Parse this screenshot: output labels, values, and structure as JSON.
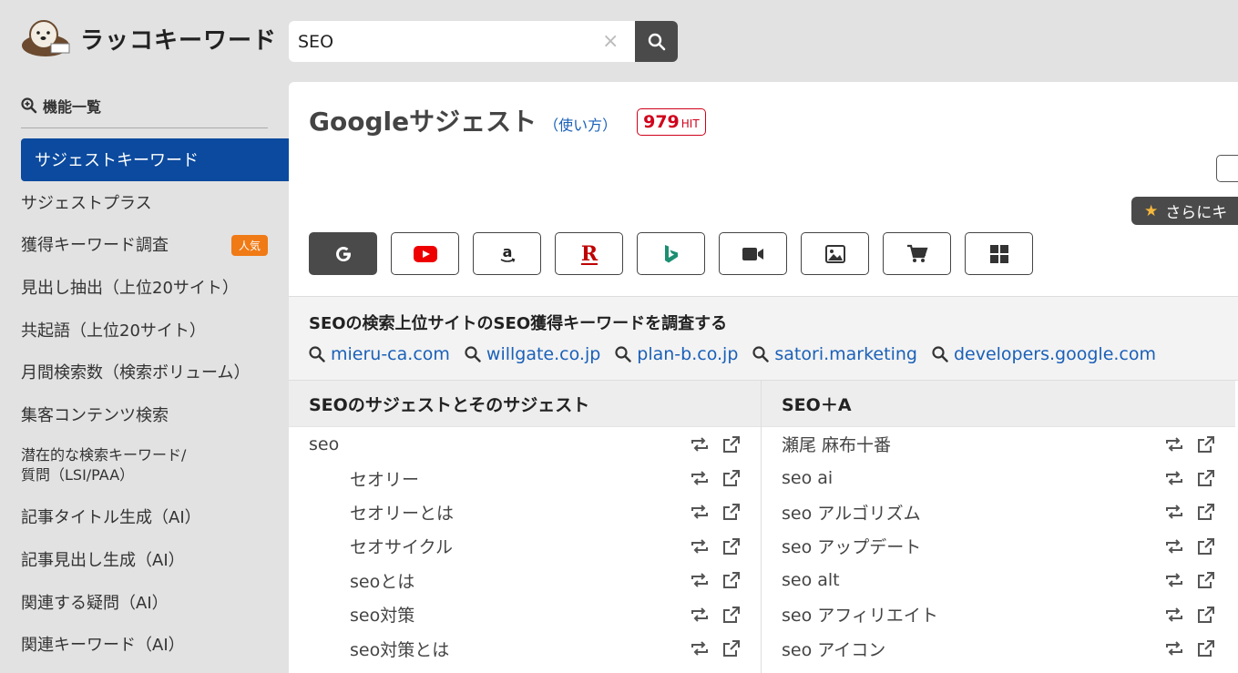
{
  "app": {
    "logo_text": "ラッコキーワード"
  },
  "search": {
    "value": "SEO",
    "clear": "×"
  },
  "sidebar": {
    "heading": "機能一覧",
    "items": [
      {
        "label": "サジェストキーワード"
      },
      {
        "label": "サジェストプラス"
      },
      {
        "label": "獲得キーワード調査",
        "badge": "人気"
      },
      {
        "label": "見出し抽出（上位20サイト）"
      },
      {
        "label": "共起語（上位20サイト）"
      },
      {
        "label": "月間検索数（検索ボリューム）"
      },
      {
        "label": "集客コンテンツ検索"
      },
      {
        "line1": "潜在的な検索キーワード/",
        "line2": "質問（LSI/PAA）"
      },
      {
        "label": "記事タイトル生成（AI）"
      },
      {
        "label": "記事見出し生成（AI）"
      },
      {
        "label": "関連する疑問（AI）"
      },
      {
        "label": "関連キーワード（AI）"
      }
    ]
  },
  "main": {
    "title": "Googleサジェスト",
    "howto": "（使い方）",
    "hit_count": "979",
    "hit_unit": "HIT",
    "more_button": "さらにキ",
    "engines": [
      "google-icon",
      "youtube-icon",
      "amazon-icon",
      "rakuten-icon",
      "bing-icon",
      "video-icon",
      "image-icon",
      "shopping-icon",
      "microsoft-icon"
    ],
    "ranking": {
      "title": "SEOの検索上位サイトのSEO獲得キーワードを調査する",
      "domains": [
        "mieru-ca.com",
        "willgate.co.jp",
        "plan-b.co.jp",
        "satori.marketing",
        "developers.google.com"
      ]
    },
    "left_column": {
      "heading": "SEOのサジェストとそのサジェスト",
      "rows": [
        "seo",
        "セオリー",
        "セオリーとは",
        "セオサイクル",
        "seoとは",
        "seo対策",
        "seo対策とは"
      ]
    },
    "right_column": {
      "heading": "SEO＋A",
      "rows": [
        "瀬尾 麻布十番",
        "seo ai",
        "seo アルゴリズム",
        "seo アップデート",
        "seo alt",
        "seo アフィリエイト",
        "seo アイコン"
      ]
    }
  },
  "colors": {
    "accent_blue": "#0b4a9e",
    "link_blue": "#1a60b8",
    "hit_red": "#d0021b",
    "popular_orange": "#f07a15",
    "dark_button": "#4a4a4a"
  }
}
